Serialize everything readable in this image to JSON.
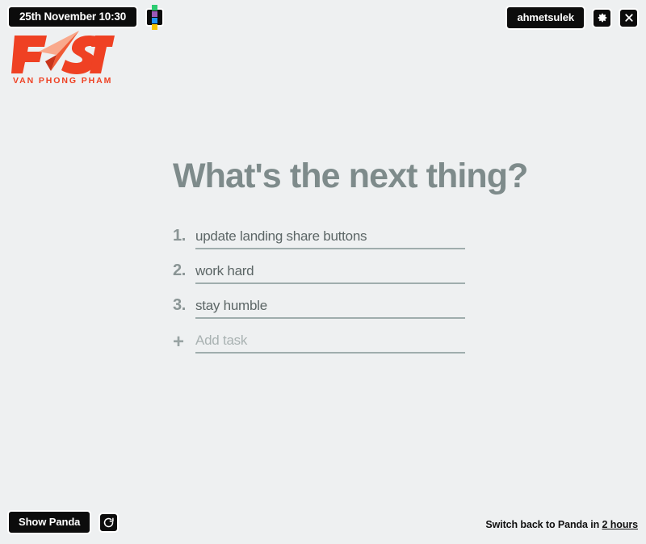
{
  "window": {
    "background_color": "#eef0f1"
  },
  "topbar": {
    "date_pill": "25th November 10:30",
    "squares_icon_name": "microsoft-squares-icon",
    "squares_colors": [
      "#2ecc71",
      "#9b59b6",
      "#2196f3",
      "#f5c400"
    ],
    "username_button": "ahmetsulek",
    "settings_icon_name": "gear-icon",
    "close_icon_name": "close-icon"
  },
  "logo": {
    "text": "FAST",
    "tagline": "VAN PHONG PHAM",
    "color": "#ef4123",
    "plane_color": "#f9a98c"
  },
  "main": {
    "title": "What's the next thing?",
    "title_color": "#7e8b8b",
    "tasks": [
      {
        "index": "1.",
        "text": "update landing share buttons"
      },
      {
        "index": "2.",
        "text": "work hard"
      },
      {
        "index": "3.",
        "text": "stay humble"
      }
    ],
    "add_task": {
      "index": "+",
      "placeholder": "Add task"
    }
  },
  "bottombar": {
    "show_panda_button": "Show Panda",
    "refresh_icon_name": "refresh-icon",
    "switch_prefix": "Switch back to Panda in ",
    "switch_link": "2 hours"
  }
}
